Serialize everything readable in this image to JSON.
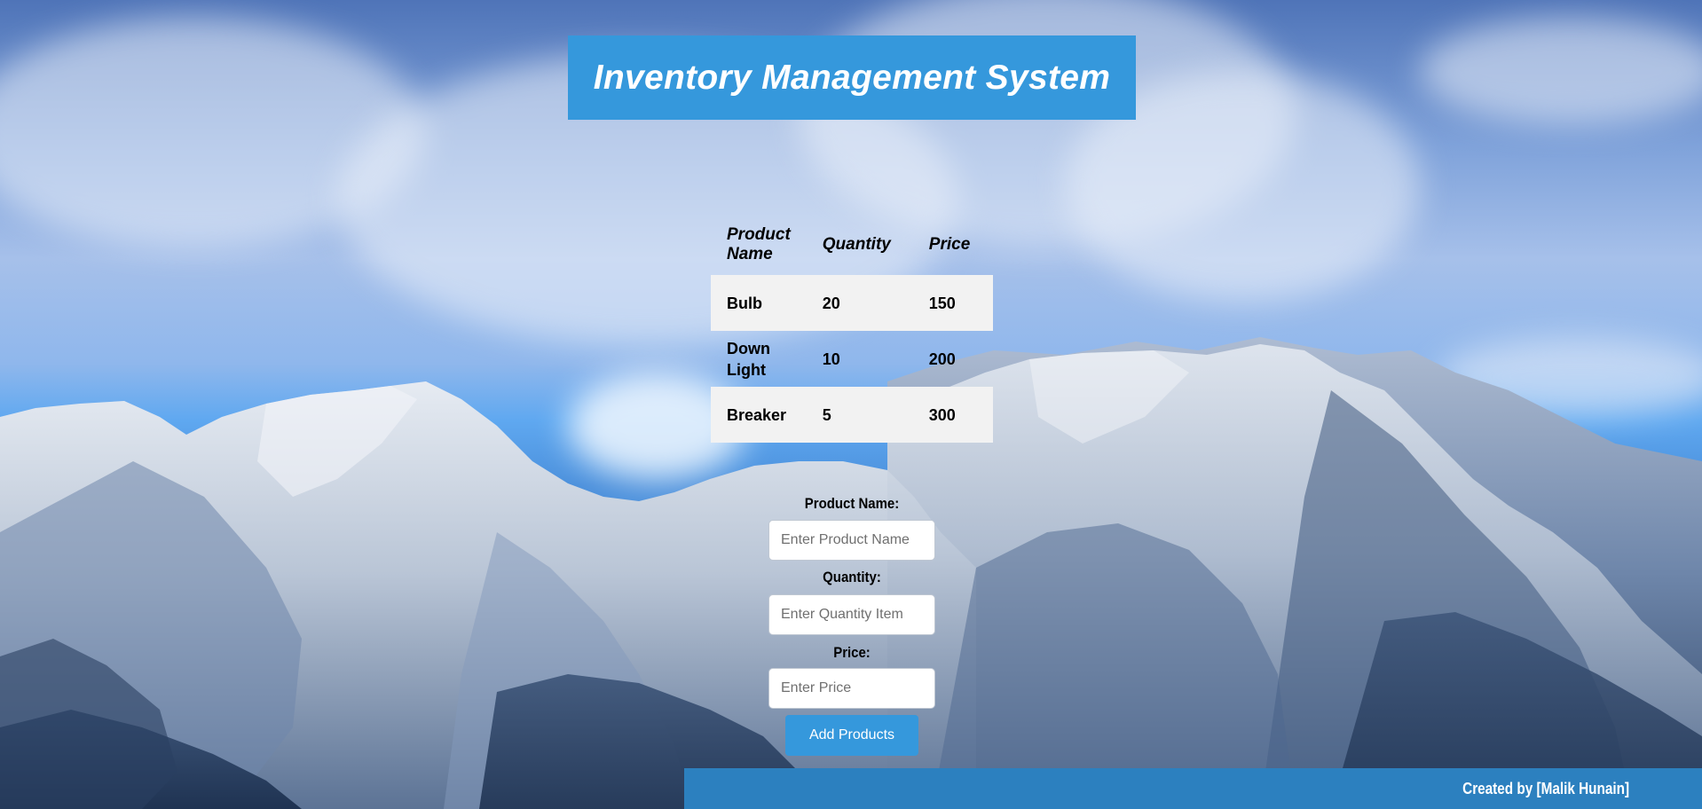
{
  "header": {
    "title": "Inventory Management System"
  },
  "table": {
    "headers": [
      "Product Name",
      "Quantity",
      "Price"
    ],
    "rows": [
      [
        "Bulb",
        "20",
        "150"
      ],
      [
        "Down Light",
        "10",
        "200"
      ],
      [
        "Breaker",
        "5",
        "300"
      ]
    ]
  },
  "form": {
    "product_name": {
      "label": "Product Name:",
      "placeholder": "Enter Product Name"
    },
    "quantity": {
      "label": "Quantity:",
      "placeholder": "Enter Quantity Item"
    },
    "price": {
      "label": "Price:",
      "placeholder": "Enter Price"
    },
    "submit_label": "Add Products"
  },
  "footer": {
    "credit": "Created by [Malik Hunain]"
  },
  "colors": {
    "accent": "#3598dc",
    "footer_bg": "#2c80bf",
    "row_shade": "#f2f2f2"
  }
}
